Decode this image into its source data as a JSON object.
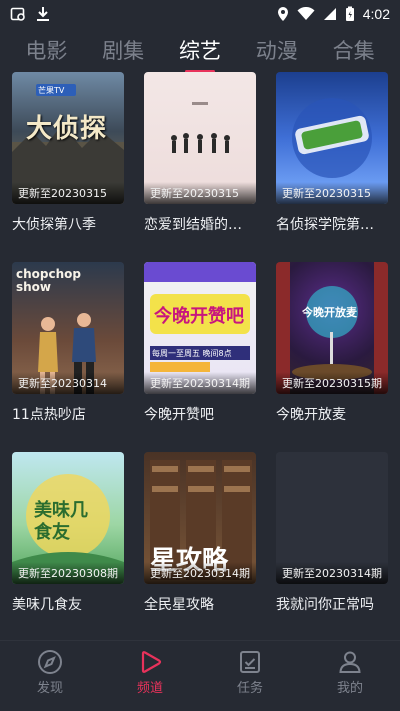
{
  "status_bar": {
    "time": "4:02",
    "left_icons": [
      "image-icon",
      "download-icon"
    ],
    "right_icons": [
      "location-icon",
      "wifi-icon",
      "signal-icon",
      "battery-icon"
    ]
  },
  "tabs": [
    {
      "label": "电影",
      "active": false
    },
    {
      "label": "剧集",
      "active": false
    },
    {
      "label": "综艺",
      "active": true
    },
    {
      "label": "动漫",
      "active": false
    },
    {
      "label": "合集",
      "active": false
    }
  ],
  "shows": [
    {
      "title": "大侦探第八季",
      "update": "更新至20230315"
    },
    {
      "title": "恋爱到结婚的…",
      "update": "更新至20230315"
    },
    {
      "title": "名侦探学院第…",
      "update": "更新至20230315"
    },
    {
      "title": "11点热吵店",
      "update": "更新至20230314"
    },
    {
      "title": "今晚开赞吧",
      "update": "更新至20230314期"
    },
    {
      "title": "今晚开放麦",
      "update": "更新至20230315期"
    },
    {
      "title": "美味几食友",
      "update": "更新至20230308期"
    },
    {
      "title": "全民星攻略",
      "update": "更新至20230314期"
    },
    {
      "title": "我就问你正常吗",
      "update": "更新至20230314期"
    }
  ],
  "poster_text": {
    "p1_logo": "大侦探",
    "p1_badge": "芒果TV",
    "p4_logo": "chopchop show",
    "p5_logo": "今晚开赞吧",
    "p5_sub": "每周一至周五 晚间8点",
    "p6_logo": "今晚开放麦",
    "p7_logo": "美味几食友",
    "p8_logo": "星攻略"
  },
  "bottom_nav": [
    {
      "label": "发现",
      "icon": "compass-icon",
      "active": false
    },
    {
      "label": "频道",
      "icon": "play-icon",
      "active": true
    },
    {
      "label": "任务",
      "icon": "task-icon",
      "active": false
    },
    {
      "label": "我的",
      "icon": "user-icon",
      "active": false
    }
  ],
  "colors": {
    "background": "#262a33",
    "accent": "#e8325b",
    "inactive": "#7e838e"
  }
}
